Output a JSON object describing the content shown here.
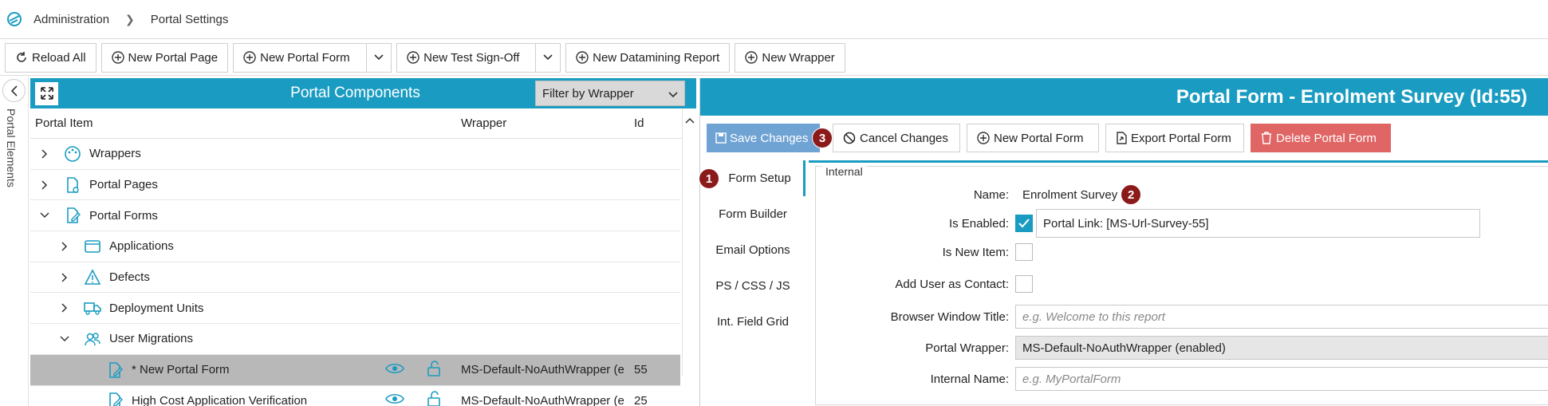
{
  "breadcrumb": {
    "items": [
      "Administration",
      "Portal Settings"
    ]
  },
  "toolbar": {
    "reload": "Reload All",
    "new_page": "New Portal Page",
    "new_form": "New Portal Form",
    "new_test": "New Test Sign-Off",
    "new_datamining": "New Datamining Report",
    "new_wrapper": "New Wrapper"
  },
  "side": {
    "label": "Portal Elements"
  },
  "left": {
    "title": "Portal Components",
    "filter": "Filter by Wrapper",
    "columns": {
      "item": "Portal Item",
      "wrapper": "Wrapper",
      "id": "Id"
    },
    "rows": [
      {
        "label": "Wrappers"
      },
      {
        "label": "Portal Pages"
      },
      {
        "label": "Portal Forms"
      },
      {
        "label": "Applications"
      },
      {
        "label": "Defects"
      },
      {
        "label": "Deployment Units"
      },
      {
        "label": "User Migrations"
      },
      {
        "label": "* New Portal Form",
        "wrapper": "MS-Default-NoAuthWrapper (e",
        "id": "55"
      },
      {
        "label": "High Cost Application Verification",
        "wrapper": "MS-Default-NoAuthWrapper (e",
        "id": "25"
      }
    ]
  },
  "right": {
    "title": "Portal Form -  Enrolment Survey  (Id:55)",
    "buttons": {
      "save": "Save Changes",
      "cancel": "Cancel Changes",
      "new_form": "New Portal Form",
      "export": "Export Portal Form",
      "delete": "Delete Portal Form"
    },
    "badges": {
      "one": "1",
      "two": "2",
      "three": "3"
    },
    "tabs": [
      "Form Setup",
      "Form Builder",
      "Email Options",
      "PS / CSS / JS",
      "Int. Field Grid"
    ],
    "group": "Internal",
    "fields": {
      "name_label": "Name:",
      "name_value": "Enrolment Survey",
      "enabled_label": "Is Enabled:",
      "portal_link": "Portal Link: [MS-Url-Survey-55]",
      "new_item_label": "Is New Item:",
      "add_user_label": "Add User as Contact:",
      "browser_title_label": "Browser Window Title:",
      "browser_title_placeholder": "e.g. Welcome to this report",
      "wrapper_label": "Portal Wrapper:",
      "wrapper_value": "MS-Default-NoAuthWrapper (enabled)",
      "internal_name_label": "Internal Name:",
      "internal_name_placeholder": "e.g. MyPortalForm"
    }
  },
  "colors": {
    "accent": "#1a9cc2",
    "danger": "#e06666",
    "badge": "#8b1a1a",
    "selected_row": "#b8b8b8"
  }
}
